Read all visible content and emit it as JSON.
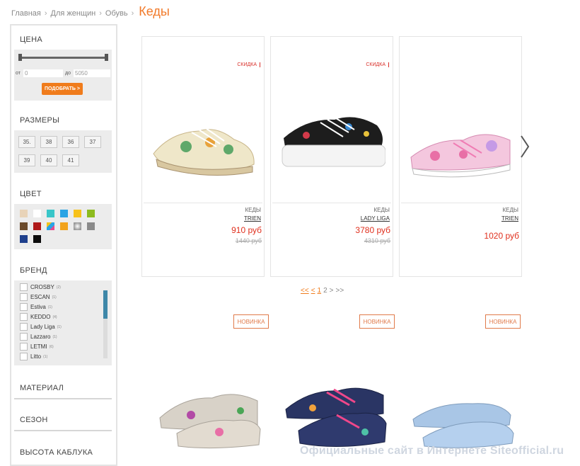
{
  "breadcrumb": {
    "items": [
      "Главная",
      "Для женщин",
      "Обувь"
    ],
    "current": "Кеды"
  },
  "filters": {
    "price": {
      "title": "ЦЕНА",
      "from_label": "от",
      "from_value": "0",
      "to_label": "до",
      "to_value": "5050",
      "apply": "ПОДОБРАТЬ >"
    },
    "sizes": {
      "title": "РАЗМЕРЫ",
      "values": [
        "35.",
        "38",
        "36",
        "37",
        "39",
        "40",
        "41"
      ]
    },
    "color": {
      "title": "ЦВЕТ",
      "swatches": [
        "#e8d3b8",
        "#ffffff",
        "#39c6c9",
        "#2aa4e4",
        "#f7c21b",
        "#8dbb1e",
        "#6b4a2a",
        "#b01a1a",
        "#multicolor",
        "#f2a31c",
        "#bdbdbd",
        "#8a8a8a",
        "#1e3f8c",
        "#0b0b0b"
      ]
    },
    "brand": {
      "title": "БРЕНД",
      "items": [
        {
          "name": "CROSBY",
          "count": "(2)"
        },
        {
          "name": "ESCAN",
          "count": "(1)"
        },
        {
          "name": "Estiva",
          "count": "(1)"
        },
        {
          "name": "KEDDO",
          "count": "(4)"
        },
        {
          "name": "Lady Liga",
          "count": "(1)"
        },
        {
          "name": "Lazzaro",
          "count": "(1)"
        },
        {
          "name": "LETMI",
          "count": "(6)"
        },
        {
          "name": "Litto",
          "count": "(1)"
        }
      ]
    },
    "material": {
      "title": "МАТЕРИАЛ"
    },
    "season": {
      "title": "СЕЗОН"
    },
    "heel": {
      "title": "ВЫСОТА КАБЛУКА"
    }
  },
  "products": [
    {
      "badge": "СКИДКА",
      "category": "КЕДЫ",
      "brand": "TRIEN",
      "price": "910 руб",
      "old_price": "1440 руб"
    },
    {
      "badge": "СКИДКА",
      "category": "КЕДЫ",
      "brand": "LADY LIGA",
      "price": "3780 руб",
      "old_price": "4310 руб"
    },
    {
      "badge": "",
      "category": "КЕДЫ",
      "brand": "TRIEN",
      "price": "1020 руб",
      "old_price": ""
    }
  ],
  "pagination": {
    "first": "<<",
    "prev": "<",
    "page1": "1",
    "page2": "2",
    "next": ">",
    "last": ">>"
  },
  "new_badge": "НОВИНКА",
  "watermark": "Официальные сайт в Интернете Siteofficial.ru",
  "colors": {
    "accent": "#f07c1c",
    "price": "#e0301e",
    "sale": "#d9302a"
  }
}
